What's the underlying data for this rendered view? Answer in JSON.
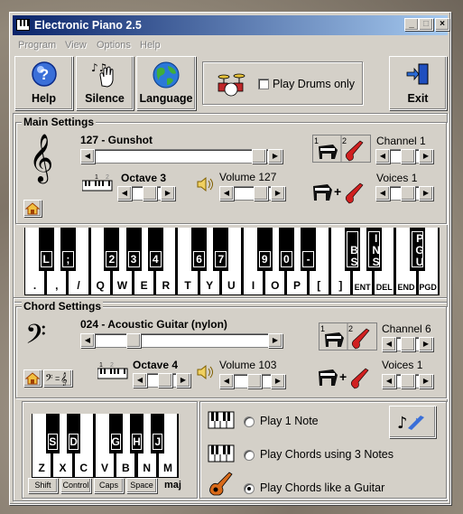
{
  "window": {
    "title": "Electronic Piano 2.5"
  },
  "titlebar_buttons": {
    "minimize": "_",
    "maximize": "□",
    "close": "×"
  },
  "menu": [
    "Program",
    "View",
    "Options",
    "Help"
  ],
  "toolbar": {
    "help": "Help",
    "silence": "Silence",
    "language": "Language",
    "play_drums_only": "Play Drums only",
    "exit": "Exit",
    "drums_checked": false
  },
  "main": {
    "title": "Main Settings",
    "instrument": "127 - Gunshot",
    "octave": "Octave 3",
    "volume": "Volume 127",
    "channel": "Channel 1",
    "voices": "Voices 1",
    "kbd_nums": [
      "1",
      "2"
    ],
    "inst_nums": [
      "1",
      "2"
    ],
    "white_keys": [
      ".",
      ",",
      "/",
      "Q",
      "W",
      "E",
      "R",
      "T",
      "Y",
      "U",
      "I",
      "O",
      "P",
      "[",
      "]",
      "ENT",
      "DEL",
      "END",
      "PGD"
    ],
    "black_keys": [
      "L",
      ";",
      "2",
      "3",
      "4",
      "6",
      "7",
      "9",
      "0",
      "-",
      "BS",
      "INS",
      "PGU"
    ]
  },
  "chord": {
    "title": "Chord Settings",
    "instrument": "024 - Acoustic Guitar (nylon)",
    "octave": "Octave 4",
    "volume": "Volume 103",
    "channel": "Channel 6",
    "voices": "Voices 1",
    "kbd_nums": [
      "1",
      "2"
    ],
    "inst_nums": [
      "1",
      "2"
    ],
    "white_keys": [
      "Z",
      "X",
      "C",
      "V",
      "B",
      "N",
      "M"
    ],
    "black_keys": [
      "S",
      "D",
      "G",
      "H",
      "J"
    ],
    "mod_keys": [
      "Shift",
      "Control",
      "Caps",
      "Space"
    ],
    "chord_type": "maj",
    "options": [
      "Play 1 Note",
      "Play Chords using 3 Notes",
      "Play Chords like a Guitar"
    ],
    "selected_option": 2
  },
  "colors": {
    "titlebar": "#0a246a",
    "face": "#d4d0c8"
  }
}
